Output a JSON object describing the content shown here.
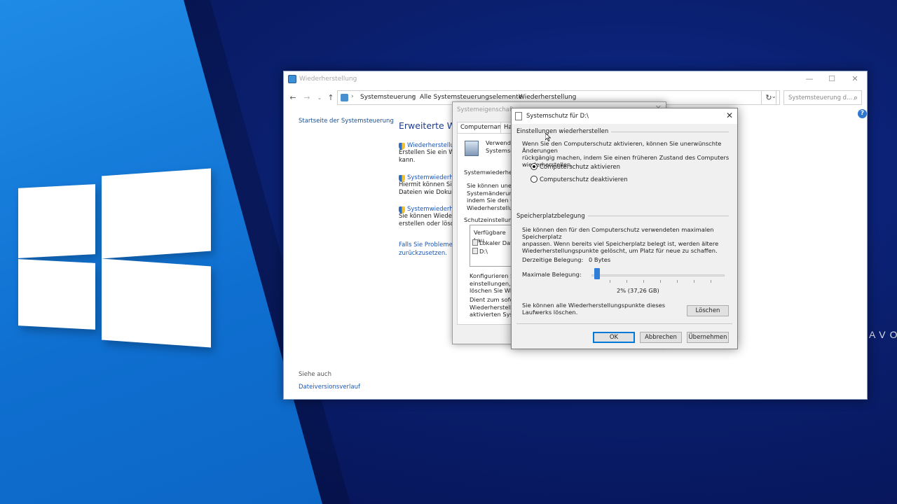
{
  "background": {
    "accent_blue": "#1f8be6",
    "dark_navy": "#0a1f6e",
    "logo": "windows-logo",
    "watermark_text": "AVO"
  },
  "explorer": {
    "title": "Wiederherstellung",
    "icon": "control-panel-icon",
    "controls": {
      "minimize": "—",
      "maximize": "☐",
      "close": "✕"
    },
    "breadcrumb": [
      "Systemsteuerung",
      "Alle Systemsteuerungselemente",
      "Wiederherstellung"
    ],
    "search_placeholder": "Systemsteuerung d...",
    "sidebar_link": "Startseite der Systemsteuerung",
    "heading": "Erweiterte Wiede",
    "tasks": [
      {
        "link": "Wiederherstellu",
        "desc": "Erstellen Sie ein Wie\nkann."
      },
      {
        "link": "Systemwiederhe",
        "desc": "Hiermit können Sie\nDateien wie Dokum"
      },
      {
        "link": "Systemwiederhe",
        "desc": "Sie können Wieder\nerstellen oder lösch"
      }
    ],
    "problem_link": "Falls Sie Probleme m\nzurückzusetzen.",
    "see_also": "Siehe auch",
    "see_also_link": "Dateiversionsverlauf"
  },
  "sysprop": {
    "title": "Systemeigenschafte",
    "tabs": [
      "Computername",
      "Ha"
    ],
    "icon_text": "Verwende\nSystemsc",
    "section1": "Systemwiederherstell",
    "section1_text": "Sie können unerwü\nSystemänderunge\nindem Sie den Co\nWiederherstellung",
    "section2": "Schutzeinstellungen",
    "list_header": "Verfügbare Lau",
    "drives": [
      "Lokaler Dat",
      "D:\\"
    ],
    "config_text": "Konfigurieren Sie\neinstellungen, ve\nlöschen Sie Wied",
    "create_text": "Dient zum soforti\nWiederherstellun\naktivierten Syste"
  },
  "sysschutz": {
    "title": "Systemschutz für D:\\",
    "close": "✕",
    "group1_title": "Einstellungen wiederherstellen",
    "group1_text": "Wenn Sie den Computerschutz aktivieren, können Sie unerwünschte Änderungen\nrückgängig machen, indem Sie einen früheren Zustand des Computers\nwiederherstellen.",
    "radio_on": "Computerschutz aktivieren",
    "radio_off": "Computerschutz deaktivieren",
    "selected_radio": "on",
    "group2_title": "Speicherplatzbelegung",
    "group2_text": "Sie können den für den Computerschutz verwendeten maximalen Speicherplatz\nanpassen. Wenn bereits viel Speicherplatz belegt ist, werden ältere\nWiederherstellungspunkte gelöscht, um Platz für neue zu schaffen.",
    "current_usage_label": "Derzeitige Belegung:",
    "current_usage_value": "0 Bytes",
    "max_usage_label": "Maximale Belegung:",
    "max_usage_percent": 2,
    "max_usage_readout": "2% (37,26 GB)",
    "delete_text": "Sie können alle Wiederherstellungspunkte dieses\nLaufwerks löschen.",
    "delete_button": "Löschen",
    "ok_button": "OK",
    "cancel_button": "Abbrechen",
    "apply_button": "Übernehmen"
  }
}
